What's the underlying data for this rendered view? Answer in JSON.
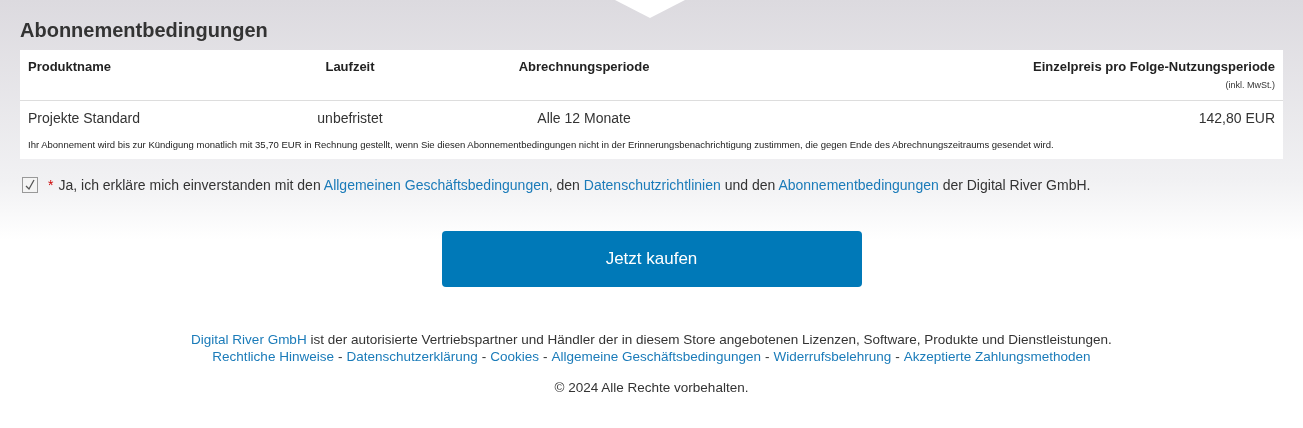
{
  "section": {
    "title": "Abonnementbedingungen"
  },
  "table": {
    "columns": [
      {
        "label": "Produktname"
      },
      {
        "label": "Laufzeit"
      },
      {
        "label": "Abrechnungsperiode"
      },
      {
        "label": "Einzelpreis pro Folge-Nutzungsperiode",
        "note": "(inkl. MwSt.)"
      }
    ],
    "rows": [
      {
        "cells": [
          "Projekte Standard",
          "unbefristet",
          "Alle 12 Monate",
          "142,80 EUR"
        ]
      }
    ],
    "notice": "Ihr Abonnement wird bis zur Kündigung monatlich mit 35,70 EUR in Rechnung gestellt, wenn Sie diesen Abonnementbedingungen nicht in der Erinnerungsbenachrichtigung zustimmen, die gegen Ende des Abrechnungszeitraums gesendet wird."
  },
  "consent": {
    "checked": true,
    "required_mark": "*",
    "parts": [
      {
        "kind": "text",
        "text": "Ja, ich erkläre mich einverstanden mit den "
      },
      {
        "kind": "link",
        "text": "Allgemeinen Geschäftsbedingungen"
      },
      {
        "kind": "text",
        "text": ", den "
      },
      {
        "kind": "link",
        "text": "Datenschutzrichtlinien"
      },
      {
        "kind": "text",
        "text": " und den "
      },
      {
        "kind": "link",
        "text": "Abonnementbedingungen"
      },
      {
        "kind": "text",
        "text": " der Digital River GmbH."
      }
    ]
  },
  "buy_button": {
    "label": "Jetzt kaufen"
  },
  "footer": {
    "intro_link": "Digital River GmbH",
    "intro_text": " ist der autorisierte Vertriebspartner und Händler der in diesem Store angebotenen Lizenzen, Software, Produkte und Dienstleistungen.",
    "separator": "-",
    "links": [
      "Rechtliche Hinweise",
      "Datenschutzerklärung",
      "Cookies",
      "Allgemeine Geschäftsbedingungen",
      "Widerrufsbelehrung",
      "Akzeptierte Zahlungsmethoden"
    ],
    "copyright": "© 2024 Alle Rechte vorbehalten."
  }
}
